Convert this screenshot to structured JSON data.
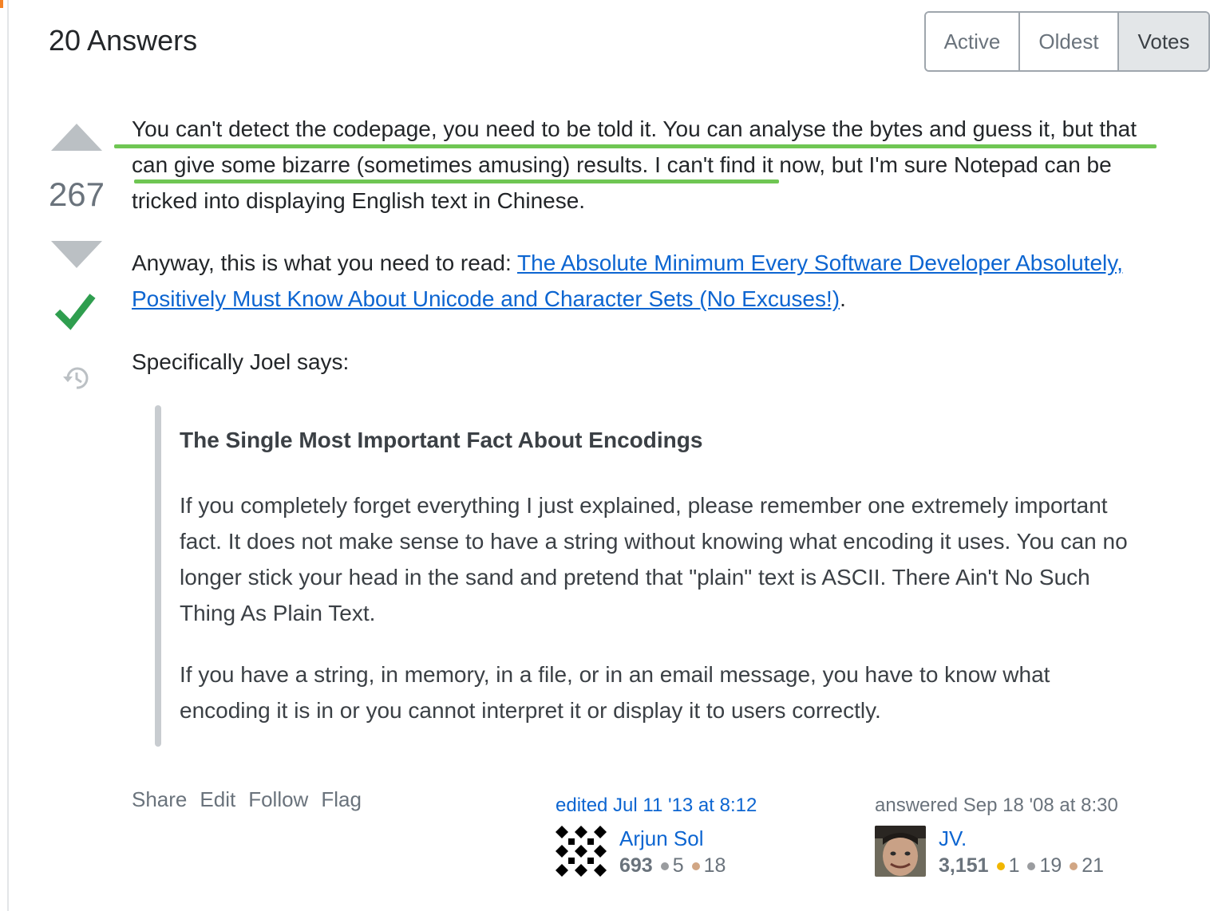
{
  "header": {
    "answers_count_title": "20 Answers",
    "sort_tabs": [
      {
        "label": "Active",
        "selected": false
      },
      {
        "label": "Oldest",
        "selected": false
      },
      {
        "label": "Votes",
        "selected": true
      }
    ]
  },
  "answer": {
    "score": "267",
    "accepted": true,
    "paragraph1": "You can't detect the codepage, you need to be told it. You can analyse the bytes and guess it, but that can give some bizarre (sometimes amusing) results. I can't find it now, but I'm sure Notepad can be tricked into displaying English text in Chinese.",
    "paragraph2_prefix": "Anyway, this is what you need to read: ",
    "paragraph2_link": "The Absolute Minimum Every Software Developer Absolutely, Positively Must Know About Unicode and Character Sets (No Excuses!)",
    "paragraph2_suffix": ".",
    "paragraph3": "Specifically Joel says:",
    "quote": {
      "title": "The Single Most Important Fact About Encodings",
      "paragraph1": "If you completely forget everything I just explained, please remember one extremely important fact. It does not make sense to have a string without knowing what encoding it uses. You can no longer stick your head in the sand and pretend that \"plain\" text is ASCII. There Ain't No Such Thing As Plain Text.",
      "paragraph2": "If you have a string, in memory, in a file, or in an email message, you have to know what encoding it is in or you cannot interpret it or display it to users correctly."
    },
    "menu": {
      "share": "Share",
      "edit": "Edit",
      "follow": "Follow",
      "flag": "Flag"
    },
    "editor": {
      "action": "edited Jul 11 '13 at 8:12",
      "name": "Arjun Sol",
      "reputation": "693",
      "silver": "5",
      "bronze": "18"
    },
    "author": {
      "action": "answered Sep 18 '08 at 8:30",
      "name": "JV.",
      "reputation": "3,151",
      "gold": "1",
      "silver": "19",
      "bronze": "21"
    }
  },
  "colors": {
    "link": "#0c65d1",
    "accepted_check": "#2f9e4f",
    "highlight_underline": "#6fc653",
    "gold_badge": "#f1b600",
    "silver_badge": "#9a9c9f",
    "bronze_badge": "#d1a684"
  },
  "icons": [
    "vote-up-icon",
    "vote-down-icon",
    "accepted-check-icon",
    "history-icon",
    "identicon-avatar",
    "user-photo-avatar"
  ]
}
